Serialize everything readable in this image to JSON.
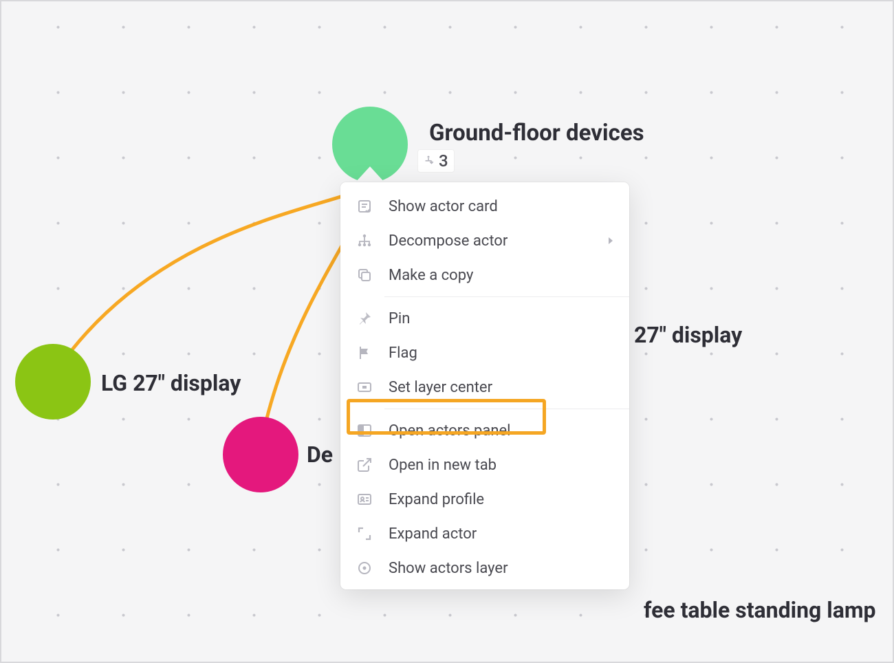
{
  "nodes": {
    "ground_floor": {
      "label": "Ground-floor devices",
      "badge_count": "3"
    },
    "lg_display": {
      "label": "LG 27\" display"
    },
    "de_partial": {
      "label": "De"
    },
    "display27_partial": {
      "label": "27\" display"
    },
    "fee_partial": {
      "label": "fee table standing lamp"
    }
  },
  "context_menu": {
    "items": [
      {
        "key": "show_card",
        "label": "Show actor card"
      },
      {
        "key": "decompose",
        "label": "Decompose actor",
        "has_submenu": true
      },
      {
        "key": "copy",
        "label": "Make a copy"
      },
      {
        "key": "pin",
        "label": "Pin"
      },
      {
        "key": "flag",
        "label": "Flag"
      },
      {
        "key": "set_center",
        "label": "Set layer center",
        "highlighted": true
      },
      {
        "key": "open_panel",
        "label": "Open actors panel"
      },
      {
        "key": "open_tab",
        "label": "Open in new tab"
      },
      {
        "key": "expand_profile",
        "label": "Expand profile"
      },
      {
        "key": "expand_actor",
        "label": "Expand actor"
      },
      {
        "key": "show_layer",
        "label": "Show actors layer"
      }
    ]
  }
}
